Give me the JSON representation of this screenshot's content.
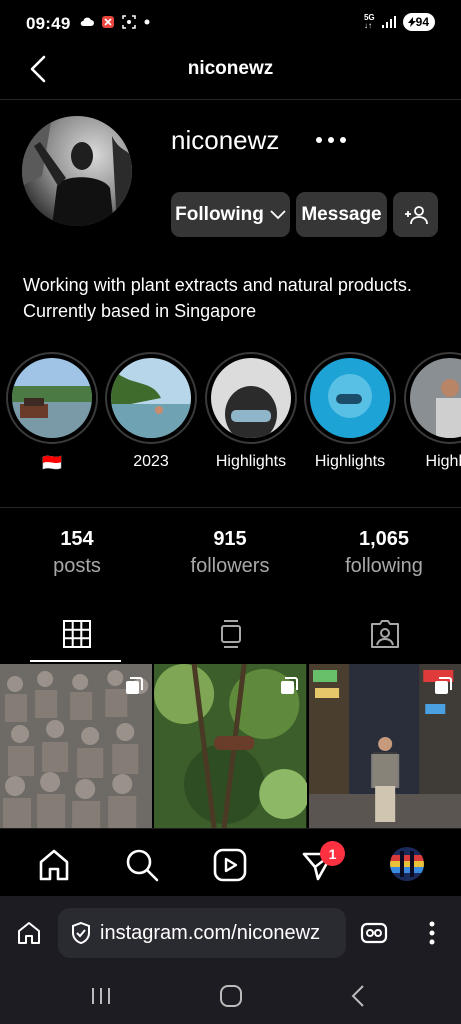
{
  "status_bar": {
    "time": "09:49",
    "battery": "94",
    "network": "5G",
    "icons": [
      "cloud-icon",
      "blocked-icon",
      "screenshot-icon",
      "dot-icon",
      "signal-icon"
    ]
  },
  "header": {
    "title": "niconewz"
  },
  "profile": {
    "username": "niconewz",
    "following_label": "Following",
    "message_label": "Message",
    "bio": "Working with plant extracts and natural products. Currently based in Singapore"
  },
  "highlights": [
    {
      "label": "🇮🇩"
    },
    {
      "label": "2023"
    },
    {
      "label": "Highlights"
    },
    {
      "label": "Highlights"
    },
    {
      "label": "Highlig"
    }
  ],
  "stats": [
    {
      "value": "154",
      "label": "posts"
    },
    {
      "value": "915",
      "label": "followers"
    },
    {
      "value": "1,065",
      "label": "following"
    }
  ],
  "tabs": [
    "grid-icon",
    "reels-feed-icon",
    "tagged-icon"
  ],
  "bottom_nav": {
    "items": [
      "home-icon",
      "search-icon",
      "reels-icon",
      "direct-icon",
      "profile-avatar"
    ],
    "direct_badge": "1"
  },
  "browser": {
    "url": "instagram.com/niconewz"
  },
  "colors": {
    "background": "#000000",
    "button_bg": "#363636",
    "badge": "#ff3040",
    "secondary_text": "#a8a8a8"
  }
}
